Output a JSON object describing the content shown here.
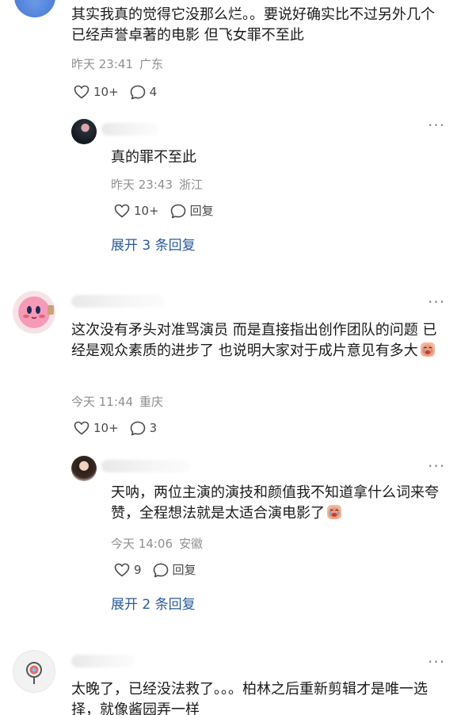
{
  "comments": [
    {
      "text": "其实我真的觉得它没那么烂。。要说好确实比不过另外几个已经声誉卓著的电影 但飞女罪不至此",
      "time": "昨天 23:41",
      "location": "广东",
      "likes": "10+",
      "replies_count": "4",
      "reply": {
        "text": "真的罪不至此",
        "time": "昨天 23:43",
        "location": "浙江",
        "likes": "10+",
        "reply_label": "回复"
      },
      "expand_label": "展开 3 条回复"
    },
    {
      "text": "这次没有矛头对准骂演员 而是直接指出创作团队的问题 已经是观众素质的进步了 也说明大家对于成片意见有多大",
      "time": "今天 11:44",
      "location": "重庆",
      "likes": "10+",
      "replies_count": "3",
      "reply": {
        "text": "天呐，两位主演的演技和颜值我不知道拿什么词来夸赞，全程想法就是太适合演电影了",
        "time": "今天 14:06",
        "location": "安徽",
        "likes": "9",
        "reply_label": "回复"
      },
      "expand_label": "展开 2 条回复"
    },
    {
      "text": "太晚了，已经没法救了。。。柏林之后重新剪辑才是唯一选择，就像酱园弄一样"
    }
  ],
  "icons": {
    "like": "heart-outline-icon",
    "comment": "chat-bubble-icon",
    "more": "more-dots-icon",
    "emoji": "crying-face-emoji"
  },
  "colors": {
    "link": "#2a5a9a",
    "meta": "#8f8f8f"
  }
}
